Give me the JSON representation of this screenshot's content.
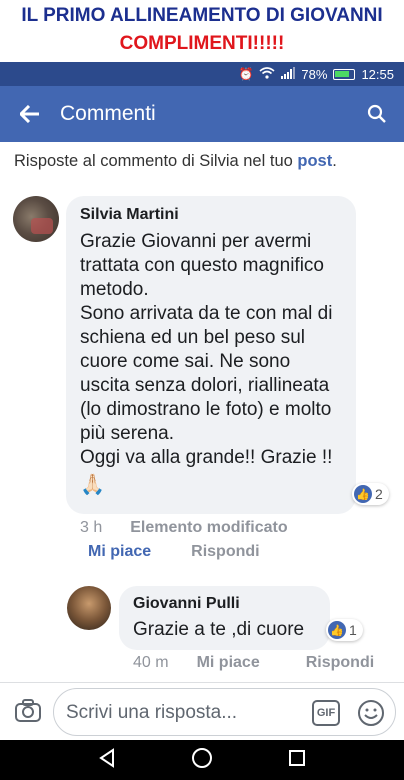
{
  "banner": {
    "title": "IL PRIMO ALLINEAMENTO DI GIOVANNI",
    "subtitle": "COMPLIMENTI!!!!!",
    "title_color": "#1c2f8f",
    "subtitle_color": "#e0161c"
  },
  "status": {
    "battery": "78%",
    "time": "12:55"
  },
  "appbar": {
    "title": "Commenti",
    "color": "#4267b2"
  },
  "context": {
    "prefix": "Risposte al commento di Silvia nel tuo ",
    "link": "post",
    "suffix": "."
  },
  "comment1": {
    "author": "Silvia Martini",
    "text": "Grazie Giovanni per avermi trattata con questo magnifico metodo.\nSono arrivata da te con mal di schiena ed un bel peso sul cuore come sai. Ne sono uscita senza dolori, riallineata (lo dimostrano le foto) e molto più serena.\nOggi va alla grande!! Grazie !!",
    "emoji": "🙏🏻",
    "reaction_count": "2",
    "time": "3 h",
    "edited": "Elemento modificato",
    "like": "Mi piace",
    "reply": "Rispondi"
  },
  "comment2": {
    "author": "Giovanni Pulli",
    "text": "Grazie a te ,di cuore",
    "reaction_count": "1",
    "time": "40 m",
    "like": "Mi piace",
    "reply": "Rispondi"
  },
  "composer": {
    "placeholder": "Scrivi una risposta...",
    "gif": "GIF"
  }
}
